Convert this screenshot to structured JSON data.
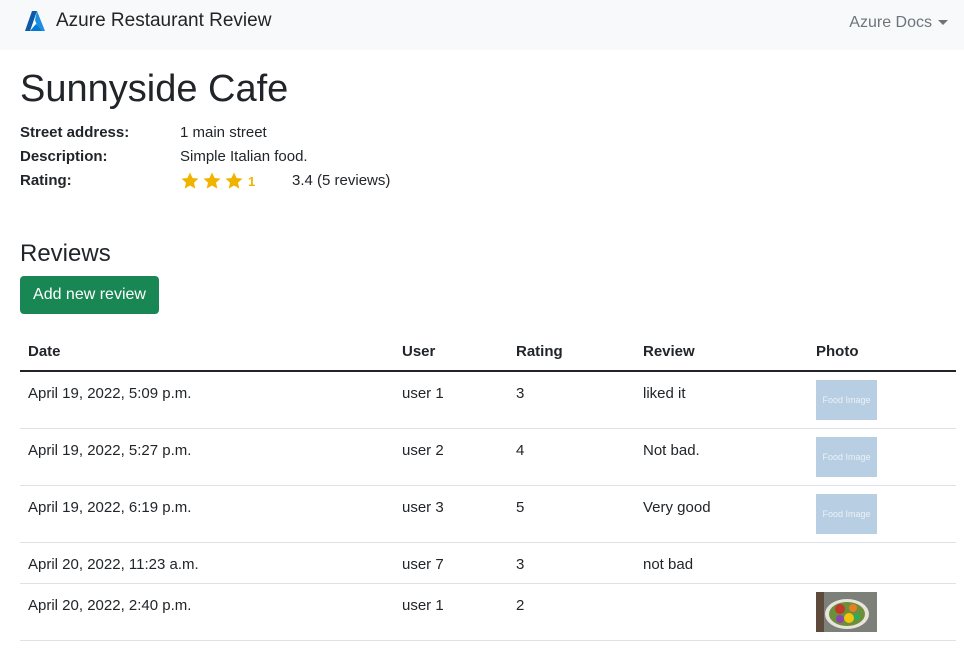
{
  "navbar": {
    "brand_text": "Azure Restaurant Review",
    "brand_icon": "azure-logo-icon",
    "docs_label": "Azure Docs"
  },
  "restaurant": {
    "name": "Sunnyside Cafe",
    "address_label": "Street address:",
    "address": "1 main street",
    "description_label": "Description:",
    "description": "Simple Italian food.",
    "rating_label": "Rating:",
    "rating_stars_full": 3,
    "rating_partial_glyph": "1",
    "rating_text": "3.4 (5 reviews)"
  },
  "reviews_section": {
    "heading": "Reviews",
    "add_button": "Add new review",
    "columns": [
      "Date",
      "User",
      "Rating",
      "Review",
      "Photo"
    ],
    "rows": [
      {
        "date": "April 19, 2022, 5:09 p.m.",
        "user": "user 1",
        "rating": "3",
        "review": "liked it",
        "photo": "placeholder",
        "photo_text": "Food Image"
      },
      {
        "date": "April 19, 2022, 5:27 p.m.",
        "user": "user 2",
        "rating": "4",
        "review": "Not bad.",
        "photo": "placeholder",
        "photo_text": "Food Image"
      },
      {
        "date": "April 19, 2022, 6:19 p.m.",
        "user": "user 3",
        "rating": "5",
        "review": "Very good",
        "photo": "placeholder",
        "photo_text": "Food Image"
      },
      {
        "date": "April 20, 2022, 11:23 a.m.",
        "user": "user 7",
        "rating": "3",
        "review": "not bad",
        "photo": "none"
      },
      {
        "date": "April 20, 2022, 2:40 p.m.",
        "user": "user 1",
        "rating": "2",
        "review": "",
        "photo": "food"
      }
    ]
  },
  "colors": {
    "navbar_bg": "#f8f9fa",
    "star": "#f0b400",
    "button_bg": "#198754",
    "azure_blue": "#0078d4"
  }
}
